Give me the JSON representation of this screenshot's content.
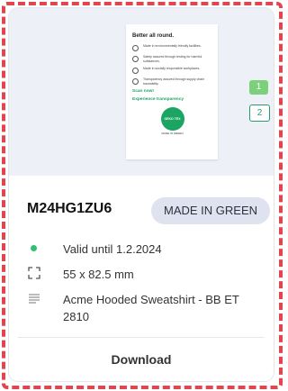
{
  "preview": {
    "doc_title": "Better all round.",
    "doc_items": [
      "Made in environmentally friendly facilities.",
      "Safety assured through testing for harmful substances.",
      "Made in socially responsible workplaces.",
      "Transparency assured through supply chain traceability."
    ],
    "doc_cta_line1": "Scan now!",
    "doc_cta_line2": "Experience transparency",
    "seal_text": "OEKO TEX",
    "seal_caption": "MADE IN GREEN",
    "pages": [
      "1",
      "2"
    ],
    "active_page": "1"
  },
  "label": {
    "code": "M24HG1ZU6",
    "badge": "MADE IN GREEN"
  },
  "details": {
    "validity": "Valid until 1.2.2024",
    "size": "55 x 82.5 mm",
    "product": "Acme Hooded Sweatshirt - BB ET 2810"
  },
  "actions": {
    "download_label": "Download"
  },
  "colors": {
    "accent_green": "#2fbf71",
    "frame_red": "#e0464f",
    "badge_bg": "#dfe3ef"
  },
  "icons": {
    "validity": "status-dot-icon",
    "size": "dimensions-icon",
    "product": "text-lines-icon"
  }
}
